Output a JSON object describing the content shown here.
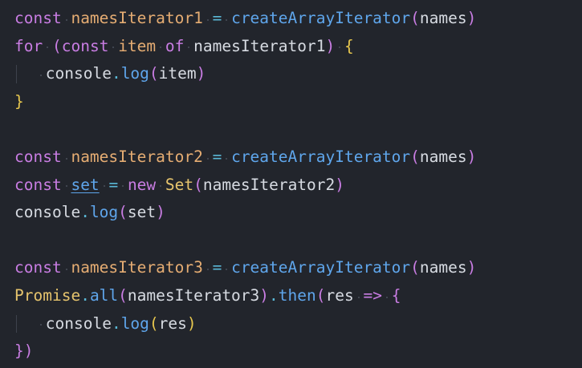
{
  "colors": {
    "background": "#22252c",
    "keyword": "#c97de3",
    "variable": "#e6ad73",
    "operator": "#5ab8d6",
    "function": "#5fa6ec",
    "text": "#d7dbe2",
    "bracket": "#e7c74e",
    "class": "#e6c46d"
  },
  "code": {
    "lines": [
      {
        "indent": 0,
        "tokens": [
          {
            "text": "const",
            "kind": "kw"
          },
          {
            "text": " ",
            "kind": "ws"
          },
          {
            "text": "namesIterator1",
            "kind": "var"
          },
          {
            "text": " ",
            "kind": "ws"
          },
          {
            "text": "=",
            "kind": "op"
          },
          {
            "text": " ",
            "kind": "ws"
          },
          {
            "text": "createArrayIterator",
            "kind": "fn"
          },
          {
            "text": "(",
            "kind": "kw"
          },
          {
            "text": "names",
            "kind": "txt"
          },
          {
            "text": ")",
            "kind": "kw"
          }
        ]
      },
      {
        "indent": 0,
        "tokens": [
          {
            "text": "for",
            "kind": "kw"
          },
          {
            "text": " ",
            "kind": "ws"
          },
          {
            "text": "(",
            "kind": "kw"
          },
          {
            "text": "const",
            "kind": "kw"
          },
          {
            "text": " ",
            "kind": "ws"
          },
          {
            "text": "item",
            "kind": "var"
          },
          {
            "text": " ",
            "kind": "ws"
          },
          {
            "text": "of",
            "kind": "kw"
          },
          {
            "text": " ",
            "kind": "ws"
          },
          {
            "text": "namesIterator1",
            "kind": "txt"
          },
          {
            "text": ")",
            "kind": "kw"
          },
          {
            "text": " ",
            "kind": "ws"
          },
          {
            "text": "{",
            "kind": "brace"
          }
        ]
      },
      {
        "indent": 1,
        "tokens": [
          {
            "text": " ",
            "kind": "ws"
          },
          {
            "text": "console",
            "kind": "txt"
          },
          {
            "text": ".",
            "kind": "op"
          },
          {
            "text": "log",
            "kind": "fn"
          },
          {
            "text": "(",
            "kind": "kw"
          },
          {
            "text": "item",
            "kind": "txt"
          },
          {
            "text": ")",
            "kind": "kw"
          }
        ]
      },
      {
        "indent": 0,
        "tokens": [
          {
            "text": "}",
            "kind": "brace"
          }
        ]
      },
      {
        "indent": 0,
        "tokens": []
      },
      {
        "indent": 0,
        "tokens": [
          {
            "text": "const",
            "kind": "kw"
          },
          {
            "text": " ",
            "kind": "ws"
          },
          {
            "text": "namesIterator2",
            "kind": "var"
          },
          {
            "text": " ",
            "kind": "ws"
          },
          {
            "text": "=",
            "kind": "op"
          },
          {
            "text": " ",
            "kind": "ws"
          },
          {
            "text": "createArrayIterator",
            "kind": "fn"
          },
          {
            "text": "(",
            "kind": "kw"
          },
          {
            "text": "names",
            "kind": "txt"
          },
          {
            "text": ")",
            "kind": "kw"
          }
        ]
      },
      {
        "indent": 0,
        "tokens": [
          {
            "text": "const",
            "kind": "kw"
          },
          {
            "text": " ",
            "kind": "ws"
          },
          {
            "text": "set",
            "kind": "lnk"
          },
          {
            "text": " ",
            "kind": "ws"
          },
          {
            "text": "=",
            "kind": "op"
          },
          {
            "text": " ",
            "kind": "ws"
          },
          {
            "text": "new",
            "kind": "kw"
          },
          {
            "text": " ",
            "kind": "ws"
          },
          {
            "text": "Set",
            "kind": "cls"
          },
          {
            "text": "(",
            "kind": "kw"
          },
          {
            "text": "namesIterator2",
            "kind": "txt"
          },
          {
            "text": ")",
            "kind": "kw"
          }
        ]
      },
      {
        "indent": 0,
        "tokens": [
          {
            "text": "console",
            "kind": "txt"
          },
          {
            "text": ".",
            "kind": "op"
          },
          {
            "text": "log",
            "kind": "fn"
          },
          {
            "text": "(",
            "kind": "kw"
          },
          {
            "text": "set",
            "kind": "txt"
          },
          {
            "text": ")",
            "kind": "kw"
          }
        ]
      },
      {
        "indent": 0,
        "tokens": []
      },
      {
        "indent": 0,
        "tokens": [
          {
            "text": "const",
            "kind": "kw"
          },
          {
            "text": " ",
            "kind": "ws"
          },
          {
            "text": "namesIterator3",
            "kind": "var"
          },
          {
            "text": " ",
            "kind": "ws"
          },
          {
            "text": "=",
            "kind": "op"
          },
          {
            "text": " ",
            "kind": "ws"
          },
          {
            "text": "createArrayIterator",
            "kind": "fn"
          },
          {
            "text": "(",
            "kind": "kw"
          },
          {
            "text": "names",
            "kind": "txt"
          },
          {
            "text": ")",
            "kind": "kw"
          }
        ]
      },
      {
        "indent": 0,
        "tokens": [
          {
            "text": "Promise",
            "kind": "cls"
          },
          {
            "text": ".",
            "kind": "op"
          },
          {
            "text": "all",
            "kind": "fn"
          },
          {
            "text": "(",
            "kind": "kw"
          },
          {
            "text": "namesIterator3",
            "kind": "txt"
          },
          {
            "text": ")",
            "kind": "kw"
          },
          {
            "text": ".",
            "kind": "op"
          },
          {
            "text": "then",
            "kind": "fn"
          },
          {
            "text": "(",
            "kind": "kw"
          },
          {
            "text": "res",
            "kind": "txt"
          },
          {
            "text": " ",
            "kind": "ws"
          },
          {
            "text": "=>",
            "kind": "kw"
          },
          {
            "text": " ",
            "kind": "ws"
          },
          {
            "text": "{",
            "kind": "kw"
          }
        ]
      },
      {
        "indent": 1,
        "tokens": [
          {
            "text": " ",
            "kind": "ws"
          },
          {
            "text": "console",
            "kind": "txt"
          },
          {
            "text": ".",
            "kind": "op"
          },
          {
            "text": "log",
            "kind": "fn"
          },
          {
            "text": "(",
            "kind": "brace"
          },
          {
            "text": "res",
            "kind": "txt"
          },
          {
            "text": ")",
            "kind": "brace"
          }
        ]
      },
      {
        "indent": 0,
        "tokens": [
          {
            "text": "}",
            "kind": "kw"
          },
          {
            "text": ")",
            "kind": "kw"
          }
        ]
      }
    ]
  }
}
